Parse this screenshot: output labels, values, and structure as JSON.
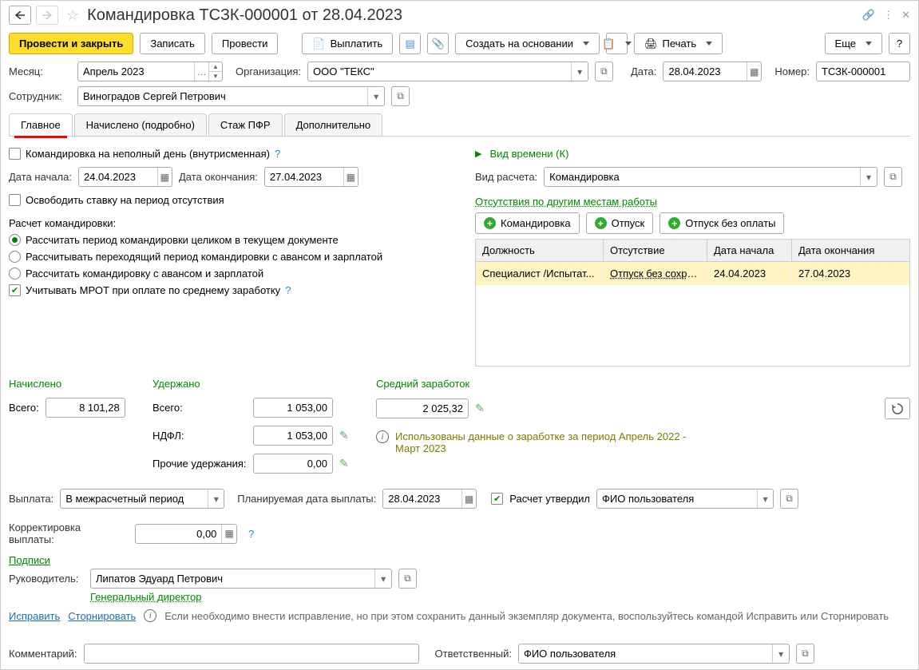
{
  "title": "Командировка ТСЗК-000001 от 28.04.2023",
  "toolbar": {
    "post_close": "Провести и закрыть",
    "write": "Записать",
    "post": "Провести",
    "pay": "Выплатить",
    "create_based": "Создать на основании",
    "print": "Печать",
    "more": "Еще",
    "help": "?"
  },
  "header": {
    "month_label": "Месяц:",
    "month_value": "Апрель 2023",
    "org_label": "Организация:",
    "org_value": "ООО \"ТЕКС\"",
    "date_label": "Дата:",
    "date_value": "28.04.2023",
    "number_label": "Номер:",
    "number_value": "ТСЗК-000001",
    "employee_label": "Сотрудник:",
    "employee_value": "Виноградов Сергей Петрович"
  },
  "tabs": [
    "Главное",
    "Начислено (подробно)",
    "Стаж ПФР",
    "Дополнительно"
  ],
  "main": {
    "partial_day": "Командировка на неполный день (внутрисменная)",
    "start_label": "Дата начала:",
    "start_value": "24.04.2023",
    "end_label": "Дата окончания:",
    "end_value": "27.04.2023",
    "release_rate": "Освободить ставку на период отсутствия",
    "calc_title": "Расчет командировки:",
    "calc_opt1": "Рассчитать период командировки целиком в текущем документе",
    "calc_opt2": "Рассчитывать переходящий период командировки с авансом и зарплатой",
    "calc_opt3": "Рассчитать командировку с авансом и зарплатой",
    "mrot": "Учитывать МРОТ при оплате по среднему заработку"
  },
  "right": {
    "time_kind": "Вид времени (К)",
    "calc_type_label": "Вид расчета:",
    "calc_type_value": "Командировка",
    "other_absences": "Отсутствия по другим местам работы",
    "btn_trip": "Командировка",
    "btn_vac": "Отпуск",
    "btn_vac_np": "Отпуск без оплаты",
    "table_head": [
      "Должность",
      "Отсутствие",
      "Дата начала",
      "Дата окончания"
    ],
    "table_row": [
      "Специалист /Испытат...",
      "Отпуск без сохра...",
      "24.04.2023",
      "27.04.2023"
    ]
  },
  "totals": {
    "accrued_head": "Начислено",
    "accrued_total_label": "Всего:",
    "accrued_total": "8 101,28",
    "withheld_head": "Удержано",
    "withheld_total_label": "Всего:",
    "withheld_total": "1 053,00",
    "ndfl_label": "НДФЛ:",
    "ndfl": "1 053,00",
    "other_label": "Прочие удержания:",
    "other": "0,00",
    "avg_head": "Средний заработок",
    "avg_value": "2 025,32",
    "avg_info": "Использованы данные о заработке за период Апрель 2022 - Март 2023"
  },
  "payout": {
    "label": "Выплата:",
    "value": "В межрасчетный период",
    "plan_label": "Планируемая дата выплаты:",
    "plan_value": "28.04.2023",
    "approved_label": "Расчет утвердил",
    "approved_value": "ФИО пользователя",
    "corr_label": "Корректировка выплаты:",
    "corr_value": "0,00"
  },
  "signatures": {
    "title": "Подписи",
    "head_label": "Руководитель:",
    "head_value": "Липатов Эдуард Петрович",
    "head_pos": "Генеральный директор"
  },
  "actions": {
    "fix": "Исправить",
    "reverse": "Сторнировать",
    "note": "Если необходимо внести исправление, но при этом сохранить данный экземпляр документа, воспользуйтесь командой Исправить или Сторнировать"
  },
  "footer": {
    "comment_label": "Комментарий:",
    "resp_label": "Ответственный:",
    "resp_value": "ФИО пользователя"
  }
}
